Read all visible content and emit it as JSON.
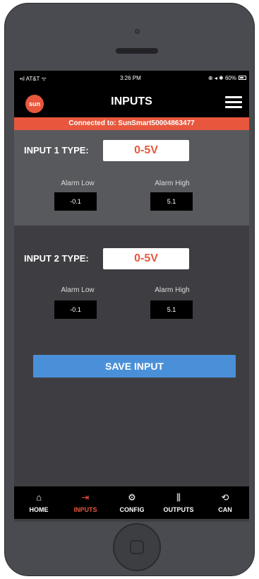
{
  "status_bar": {
    "carrier": "•ıl AT&T ᯤ",
    "time": "3:26 PM",
    "right": "⊕ ◂ ✱ 60%"
  },
  "header": {
    "title": "INPUTS"
  },
  "connection": {
    "text": "Connected to: SunSmart50004863477"
  },
  "logo": {
    "text": "sun"
  },
  "inputs": [
    {
      "label": "INPUT 1 TYPE:",
      "type": "0-5V",
      "alarm_low_label": "Alarm Low",
      "alarm_low": "-0.1",
      "alarm_high_label": "Alarm High",
      "alarm_high": "5.1"
    },
    {
      "label": "INPUT 2 TYPE:",
      "type": "0-5V",
      "alarm_low_label": "Alarm Low",
      "alarm_low": "-0.1",
      "alarm_high_label": "Alarm High",
      "alarm_high": "5.1"
    }
  ],
  "save_button": "SAVE INPUT",
  "tabs": [
    {
      "label": "HOME",
      "icon": "home-icon",
      "active": false
    },
    {
      "label": "INPUTS",
      "icon": "inputs-icon",
      "active": true
    },
    {
      "label": "CONFIG",
      "icon": "gear-icon",
      "active": false
    },
    {
      "label": "OUTPUTS",
      "icon": "outputs-icon",
      "active": false
    },
    {
      "label": "CAN",
      "icon": "can-icon",
      "active": false
    }
  ],
  "colors": {
    "accent": "#e8573d",
    "button": "#4a90d9",
    "background": "#3e3e42",
    "panel": "#58595d"
  }
}
